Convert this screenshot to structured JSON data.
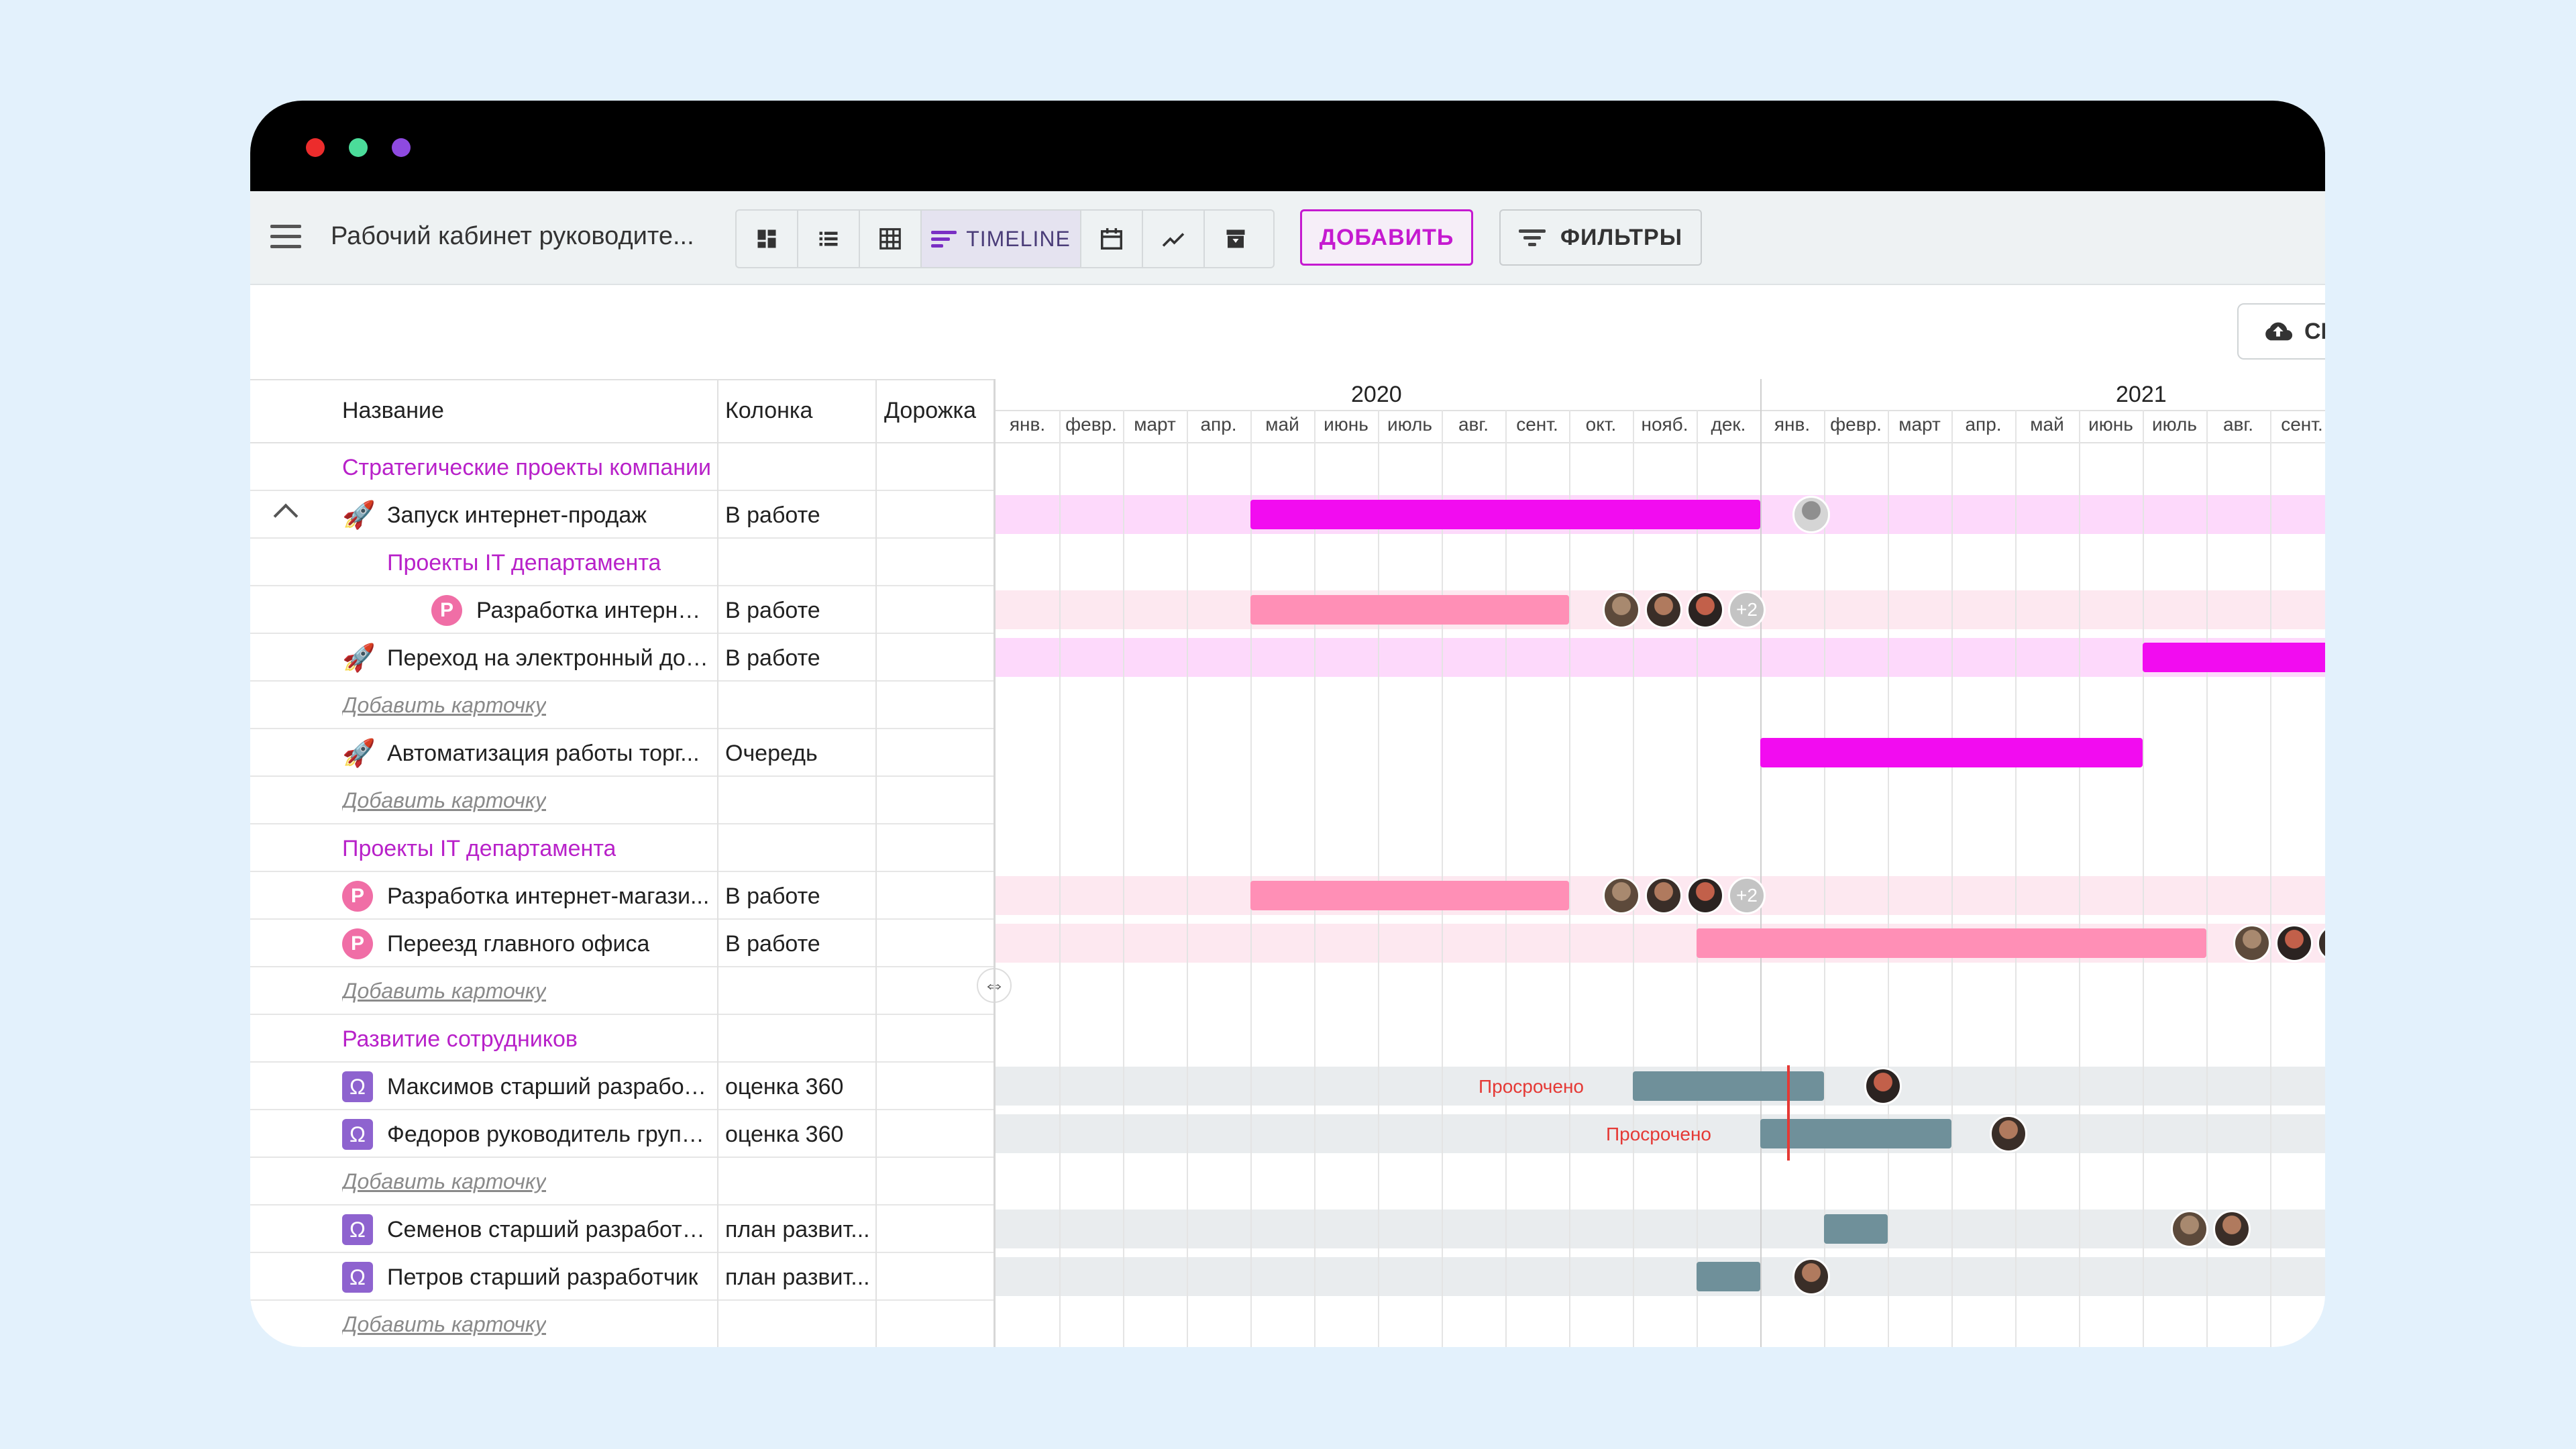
{
  "window": {
    "dots": [
      {
        "name": "close",
        "color": "#ec2c2c"
      },
      {
        "name": "minimize",
        "color": "#4bdc9a"
      },
      {
        "name": "maximize",
        "color": "#8e4ae0"
      }
    ]
  },
  "toolbar": {
    "board_title": "Рабочий кабинет руководите...",
    "views": [
      "kanban-icon",
      "list-icon",
      "table-icon",
      "timeline",
      "calendar-icon",
      "chart-icon",
      "archive-icon"
    ],
    "timeline_label": "TIMELINE",
    "add_label": "ДОБАВИТЬ",
    "filters_label": "ФИЛЬТРЫ",
    "cloud_label": "CI"
  },
  "table": {
    "headers": {
      "name": "Название",
      "column": "Колонка",
      "lane": "Дорожка"
    }
  },
  "timeline": {
    "years": [
      "2020",
      "2021"
    ],
    "months": [
      "янв.",
      "февр.",
      "март",
      "апр.",
      "май",
      "июнь",
      "июль",
      "авг.",
      "сент.",
      "окт.",
      "нояб.",
      "дек.",
      "янв.",
      "февр.",
      "март",
      "апр.",
      "май",
      "июнь",
      "июль",
      "авг.",
      "сент."
    ],
    "overdue_label": "Просрочено",
    "plus_label": "+2"
  },
  "rows": [
    {
      "type": "group",
      "title": "Стратегические проекты компании",
      "indent": 0
    },
    {
      "type": "card",
      "icon": "rocket",
      "name": "Запуск интернет-продаж",
      "column": "В работе",
      "expand": true
    },
    {
      "type": "group",
      "title": "Проекты IT департамента",
      "indent": 1
    },
    {
      "type": "card",
      "icon": "p",
      "name": "Разработка интернет-ма...",
      "column": "В работе",
      "indent": 2
    },
    {
      "type": "card",
      "icon": "rocket",
      "name": "Переход на электронный док...",
      "column": "В работе"
    },
    {
      "type": "add",
      "label": "Добавить карточку"
    },
    {
      "type": "card",
      "icon": "rocket",
      "name": "Автоматизация работы торг...",
      "column": "Очередь"
    },
    {
      "type": "add",
      "label": "Добавить карточку"
    },
    {
      "type": "group",
      "title": "Проекты IT департамента",
      "indent": 0
    },
    {
      "type": "card",
      "icon": "p",
      "name": "Разработка интернет-магази...",
      "column": "В работе"
    },
    {
      "type": "card",
      "icon": "p",
      "name": "Переезд главного офиса",
      "column": "В работе"
    },
    {
      "type": "add",
      "label": "Добавить карточку"
    },
    {
      "type": "group",
      "title": "Развитие сотрудников",
      "indent": 0
    },
    {
      "type": "card",
      "icon": "omega",
      "name": "Максимов старший разработ...",
      "column": "оценка 360"
    },
    {
      "type": "card",
      "icon": "omega",
      "name": "Федоров руководитель групп...",
      "column": "оценка 360"
    },
    {
      "type": "add",
      "label": "Добавить карточку"
    },
    {
      "type": "card",
      "icon": "omega",
      "name": "Семенов старший разработч...",
      "column": "план развит..."
    },
    {
      "type": "card",
      "icon": "omega",
      "name": "Петров старший разработчик",
      "column": "план развит..."
    },
    {
      "type": "add",
      "label": "Добавить карточку"
    }
  ],
  "colors": {
    "accent": "#c51ad0",
    "magenta_bar": "#f20cf0",
    "pink_bar": "#ff8fb6",
    "gray_bar": "#6f909a",
    "band_magenta": "#fdd9fb",
    "band_pink": "#fde8f0",
    "band_gray": "#e9ecee"
  }
}
